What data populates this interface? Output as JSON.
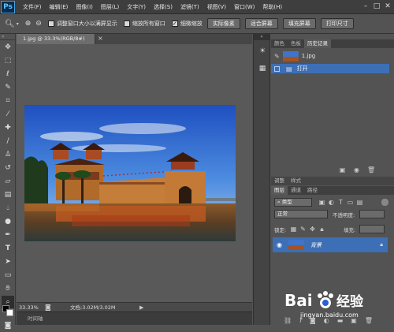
{
  "app": {
    "logo": "Ps"
  },
  "menu": [
    "文件(F)",
    "编辑(E)",
    "图像(I)",
    "图层(L)",
    "文字(Y)",
    "选择(S)",
    "滤镜(T)",
    "视图(V)",
    "窗口(W)",
    "帮助(H)"
  ],
  "options": {
    "check1": "调整窗口大小以满屏显示",
    "check2": "缩放所有窗口",
    "check3": "细微缩放",
    "btn_actual": "实际像素",
    "btn_fit": "适合屏幕",
    "btn_fill": "填充屏幕",
    "btn_print": "打印尺寸"
  },
  "document": {
    "tab": "1.jpg @ 33.3%(RGB/8#)",
    "zoom": "33.33%",
    "doc_size": "文档:3.02M/3.02M",
    "timeline_label": "时间轴"
  },
  "history_panel": {
    "tabs": [
      "颜色",
      "色板",
      "历史记录"
    ],
    "snapshot": "1.jpg",
    "step": "打开"
  },
  "layers_panel": {
    "tabs": [
      "图层",
      "通道",
      "路径"
    ],
    "kind_filter": "类型",
    "blend_mode": "正常",
    "opacity_label": "不透明度:",
    "lock_label": "锁定:",
    "fill_label": "填充:",
    "layer_name": "背景"
  },
  "mini_panel": {
    "tabs": [
      "调整",
      "样式"
    ]
  },
  "watermark": {
    "brand": "Bai",
    "brand2": "经验",
    "url": "jingyan.baidu.com"
  },
  "colors": {
    "accent": "#3d6fb6",
    "bg": "#535353"
  }
}
